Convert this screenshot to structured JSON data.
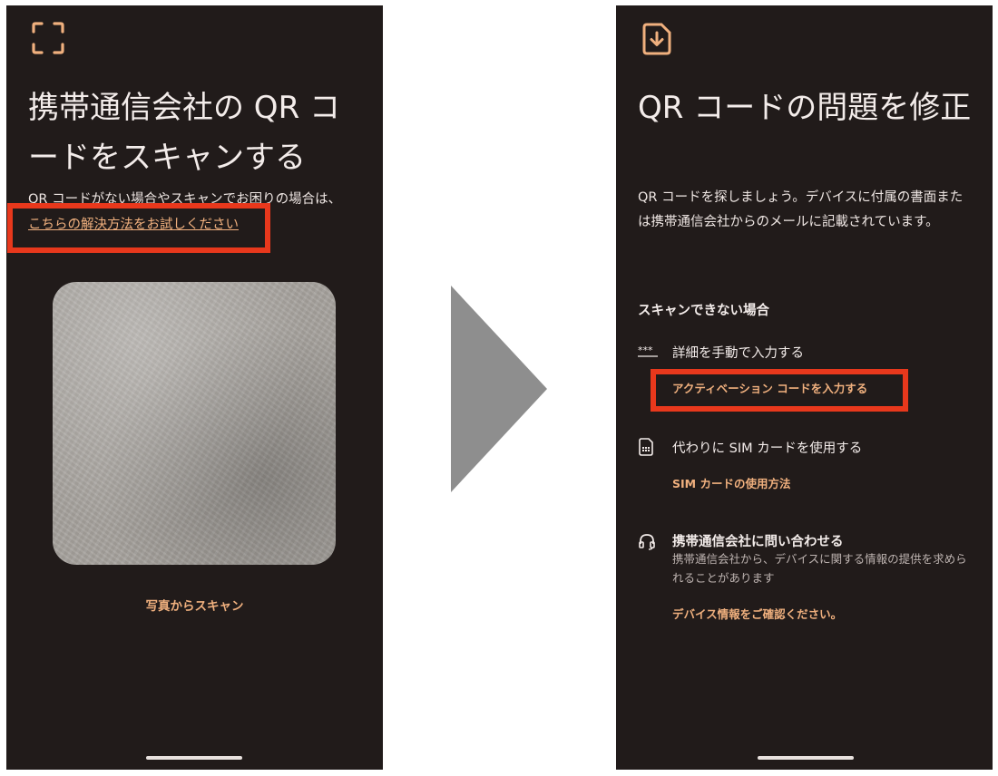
{
  "left_screen": {
    "title": "携帯通信会社の QR コードをスキャンする",
    "description": "QR コードがない場合やスキャンでお困りの場合は、",
    "troubleshoot_link": "こちらの解決方法をお試しください",
    "scan_from_photo": "写真からスキャン",
    "icons": {
      "header": "qr-scan-frame-icon"
    }
  },
  "right_screen": {
    "title": "QR コードの問題を修正",
    "description": "QR コードを探しましょう。デバイスに付属の書面または携帯通信会社からのメールに記載されています。",
    "section_title": "スキャンできない場合",
    "options": [
      {
        "icon": "password-dots-icon",
        "label": "詳細を手動で入力する",
        "action": "アクティベーション コードを入力する"
      },
      {
        "icon": "sim-card-icon",
        "label": "代わりに SIM カードを使用する",
        "action": "SIM カードの使用方法"
      },
      {
        "icon": "headset-icon",
        "label": "携帯通信会社に問い合わせる",
        "sub": "携帯通信会社から、デバイスに関する情報の提供を求められることがあります",
        "action": "デバイス情報をご確認ください。"
      }
    ],
    "icons": {
      "header": "esim-download-icon"
    }
  },
  "colors": {
    "screen_bg": "#211b1a",
    "accent": "#f0b07e",
    "highlight": "#e8381c",
    "arrow": "#8e8e8e"
  }
}
